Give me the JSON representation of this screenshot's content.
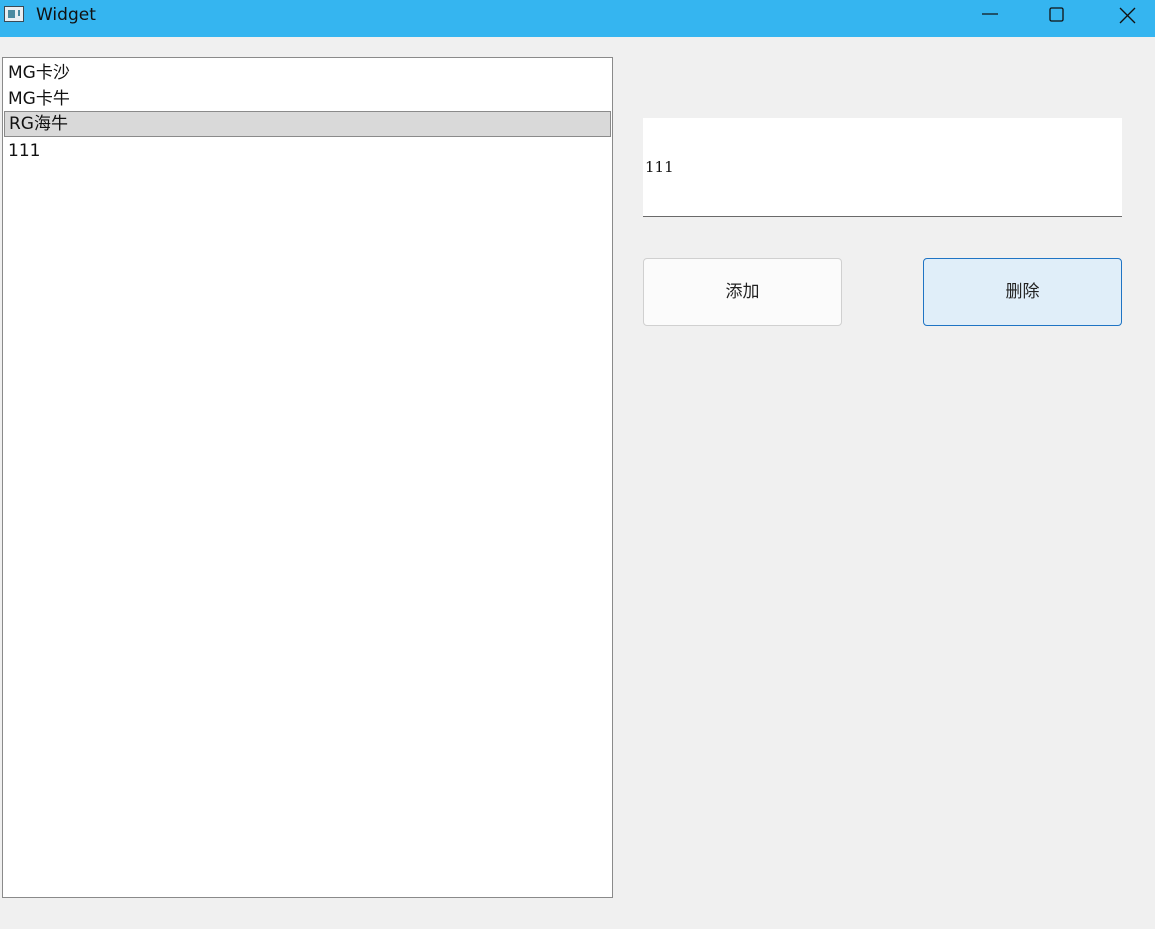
{
  "window": {
    "title": "Widget",
    "titlebar_color": "#35b5f0"
  },
  "list": {
    "items": [
      "MG卡沙",
      "MG卡牛",
      "RG海牛",
      "111"
    ],
    "selected_index": 2
  },
  "input": {
    "value": "111"
  },
  "buttons": {
    "add_label": "添加",
    "delete_label": "删除"
  },
  "colors": {
    "window_bg": "#f0f0f0",
    "selection_bg": "#d9d9d9",
    "delete_button_bg": "#e0eef9",
    "delete_button_border": "#1f74c4"
  }
}
